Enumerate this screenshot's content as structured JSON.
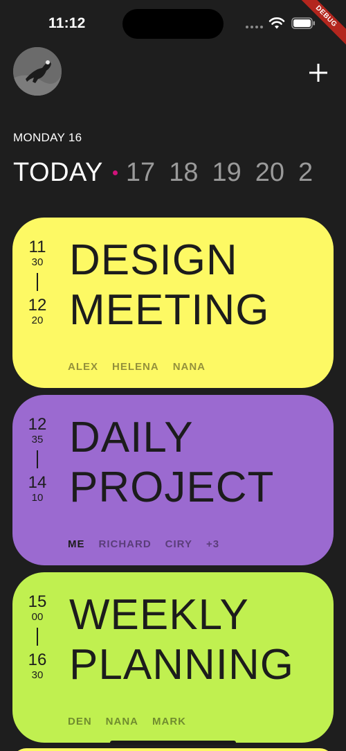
{
  "status_bar": {
    "time": "11:12",
    "debug_label": "DEBUG"
  },
  "header": {
    "avatar": "user-avatar",
    "add_icon": "plus-icon"
  },
  "date_label": "MONDAY 16",
  "day_strip": {
    "today_label": "TODAY",
    "days": [
      "17",
      "18",
      "19",
      "20",
      "2"
    ]
  },
  "events": [
    {
      "start_hour": "11",
      "start_min": "30",
      "end_hour": "12",
      "end_min": "20",
      "title_line1": "DESIGN",
      "title_line2": "MEETING",
      "attendees": [
        "ALEX",
        "HELENA",
        "NANA"
      ],
      "color": "#fdf964"
    },
    {
      "start_hour": "12",
      "start_min": "35",
      "end_hour": "14",
      "end_min": "10",
      "title_line1": "DAILY",
      "title_line2": "PROJECT",
      "attendees": [
        "ME",
        "RICHARD",
        "CIRY",
        "+3"
      ],
      "color": "#9b6ad0"
    },
    {
      "start_hour": "15",
      "start_min": "00",
      "end_hour": "16",
      "end_min": "30",
      "title_line1": "WEEKLY",
      "title_line2": "PLANNING",
      "attendees": [
        "DEN",
        "NANA",
        "MARK"
      ],
      "color": "#c0f050"
    }
  ],
  "colors": {
    "background": "#1e1e1e",
    "today_dot": "#d1127a",
    "inactive_day": "#9a9a9a"
  }
}
